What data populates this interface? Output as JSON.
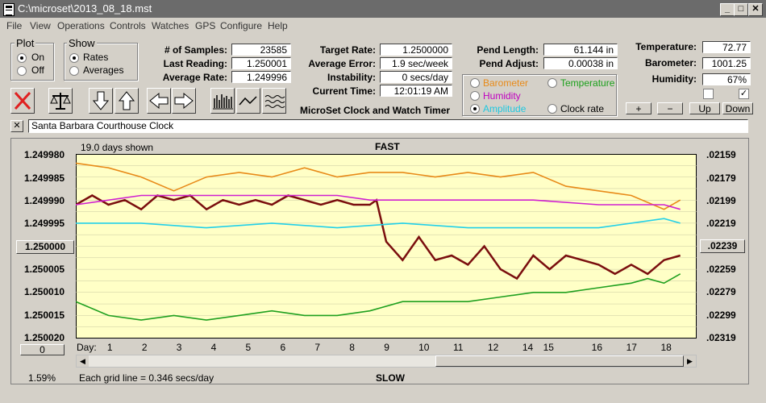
{
  "window": {
    "title": "C:\\microset\\2013_08_18.mst"
  },
  "menu": [
    "File",
    "View",
    "Operations",
    "Controls",
    "Watches",
    "GPS",
    "Configure",
    "Help"
  ],
  "plot_group": {
    "title": "Plot",
    "options": [
      "On",
      "Off"
    ],
    "selected": "On"
  },
  "show_group": {
    "title": "Show",
    "options": [
      "Rates",
      "Averages"
    ],
    "selected": "Rates"
  },
  "stats1": [
    {
      "label": "# of Samples:",
      "value": "23585"
    },
    {
      "label": "Last Reading:",
      "value": "1.250001"
    },
    {
      "label": "Average Rate:",
      "value": "1.249996"
    }
  ],
  "stats2": [
    {
      "label": "Target Rate:",
      "value": "1.2500000"
    },
    {
      "label": "Average Error:",
      "value": "1.9 sec/week"
    },
    {
      "label": "Instability:",
      "value": "0 secs/day"
    },
    {
      "label": "Current Time:",
      "value": "12:01:19 AM"
    }
  ],
  "app_caption": "MicroSet Clock and Watch Timer",
  "pend": [
    {
      "label": "Pend Length:",
      "value": "61.144 in"
    },
    {
      "label": "Pend Adjust:",
      "value": "0.00038 in"
    }
  ],
  "env": [
    {
      "label": "Temperature:",
      "value": "72.77"
    },
    {
      "label": "Barometer:",
      "value": "1001.25"
    },
    {
      "label": "Humidity:",
      "value": "67%"
    }
  ],
  "overlay_options": [
    {
      "label": "Barometer",
      "color": "#e88a18",
      "selected": false
    },
    {
      "label": "Temperature",
      "color": "#1aa01a",
      "selected": false
    },
    {
      "label": "Humidity",
      "color": "#c000c0",
      "selected": false
    },
    {
      "label": "Amplitude",
      "color": "#20c8e0",
      "selected": true
    },
    {
      "label": "Clock rate",
      "color": "#000000",
      "selected": false
    }
  ],
  "env_buttons": [
    "+",
    "−",
    "Up",
    "Down"
  ],
  "env_checks": [
    false,
    true
  ],
  "clock_name": "Santa Barbara Courthouse Clock",
  "graph": {
    "days_shown": "19.0 days shown",
    "fast_label": "FAST",
    "slow_label": "SLOW",
    "left_ticks": [
      "1.249980",
      "1.249985",
      "1.249990",
      "1.249995",
      "1.250000",
      "1.250005",
      "1.250010",
      "1.250015",
      "1.250020"
    ],
    "center_button": "1.250000",
    "right_ticks": [
      ".02159",
      ".02179",
      ".02199",
      ".02219",
      ".02239",
      ".02259",
      ".02279",
      ".02299",
      ".02319"
    ],
    "right_button": ".02239",
    "left_button": "0",
    "day_prefix": "Day:",
    "days": [
      "1",
      "2",
      "3",
      "4",
      "5",
      "6",
      "7",
      "8",
      "9",
      "10",
      "11",
      "12",
      "14",
      "15",
      "16",
      "17",
      "18"
    ],
    "grid_note": "Each grid line = 0.346 secs/day",
    "percent": "1.59%",
    "bg": "#ffffc6"
  },
  "chart_data": {
    "type": "line",
    "xlabel": "Day:",
    "ylabel": "",
    "title": "",
    "xlim": [
      0,
      19
    ],
    "ylim": [
      1.24998,
      1.25002
    ],
    "y_inverted": true,
    "series": [
      {
        "name": "Clock rate",
        "color": "#7a0e0e",
        "x": [
          0,
          0.5,
          1,
          1.5,
          2,
          2.5,
          3,
          3.5,
          4,
          4.5,
          5,
          5.5,
          6,
          6.5,
          7,
          7.5,
          8,
          8.5,
          9,
          9.2,
          9.5,
          10,
          10.5,
          11,
          11.5,
          12,
          12.5,
          13,
          13.5,
          14,
          14.5,
          15,
          15.5,
          16,
          16.5,
          17,
          17.5,
          18,
          18.5
        ],
        "y": [
          1.249991,
          1.249989,
          1.249991,
          1.24999,
          1.249992,
          1.249989,
          1.24999,
          1.249989,
          1.249992,
          1.24999,
          1.249991,
          1.24999,
          1.249991,
          1.249989,
          1.24999,
          1.249991,
          1.24999,
          1.249991,
          1.249991,
          1.24999,
          1.249999,
          1.250003,
          1.249998,
          1.250003,
          1.250002,
          1.250004,
          1.25,
          1.250005,
          1.250007,
          1.250002,
          1.250005,
          1.250002,
          1.250003,
          1.250004,
          1.250006,
          1.250004,
          1.250006,
          1.250003,
          1.250002
        ]
      },
      {
        "name": "Barometer",
        "color": "#e88a18",
        "x": [
          0,
          1,
          2,
          3,
          4,
          5,
          6,
          7,
          8,
          9,
          10,
          11,
          12,
          13,
          14,
          15,
          16,
          17,
          18,
          18.5
        ],
        "y": [
          1.249982,
          1.249983,
          1.249985,
          1.249988,
          1.249985,
          1.249984,
          1.249985,
          1.249983,
          1.249985,
          1.249984,
          1.249984,
          1.249985,
          1.249984,
          1.249985,
          1.249984,
          1.249987,
          1.249988,
          1.249989,
          1.249992,
          1.24999
        ]
      },
      {
        "name": "Humidity",
        "color": "#d020d0",
        "x": [
          0,
          2,
          4,
          6,
          8,
          9,
          10,
          12,
          14,
          16,
          18,
          18.5
        ],
        "y": [
          1.249991,
          1.249989,
          1.249989,
          1.249989,
          1.249989,
          1.24999,
          1.24999,
          1.24999,
          1.24999,
          1.249991,
          1.249991,
          1.249992
        ]
      },
      {
        "name": "Amplitude",
        "color": "#22d0e8",
        "x": [
          0,
          2,
          4,
          6,
          8,
          10,
          12,
          14,
          16,
          18,
          18.5
        ],
        "y": [
          1.249995,
          1.249995,
          1.249996,
          1.249995,
          1.249996,
          1.249995,
          1.249996,
          1.249996,
          1.249996,
          1.249994,
          1.249995
        ]
      },
      {
        "name": "Temperature",
        "color": "#1fa01f",
        "x": [
          0,
          1,
          2,
          3,
          4,
          5,
          6,
          7,
          8,
          9,
          10,
          11,
          12,
          13,
          14,
          15,
          16,
          17,
          17.5,
          18,
          18.5
        ],
        "y": [
          1.250012,
          1.250015,
          1.250016,
          1.250015,
          1.250016,
          1.250015,
          1.250014,
          1.250015,
          1.250015,
          1.250014,
          1.250012,
          1.250012,
          1.250012,
          1.250011,
          1.25001,
          1.25001,
          1.250009,
          1.250008,
          1.250007,
          1.250008,
          1.250006
        ]
      }
    ]
  }
}
